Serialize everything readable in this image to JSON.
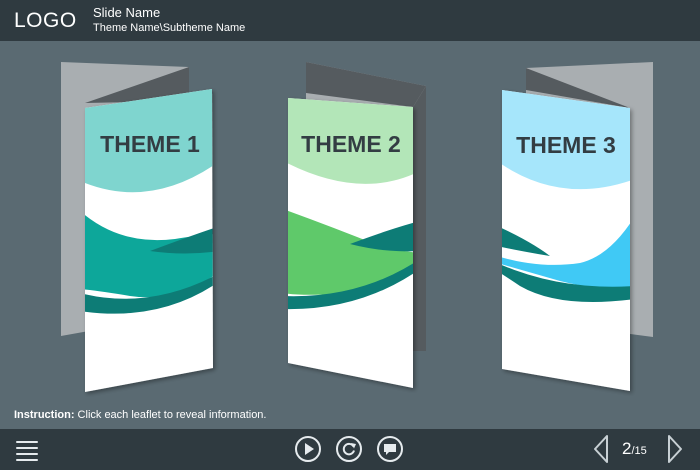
{
  "header": {
    "logo": "LOGO",
    "slide_name": "Slide Name",
    "theme_path": "Theme Name\\Subtheme Name"
  },
  "leaflets": [
    {
      "title": "THEME 1",
      "color_light": "#7fd5cf",
      "color_main": "#0ea79a",
      "color_dark": "#0b7b76"
    },
    {
      "title": "THEME 2",
      "color_light": "#b3e6b8",
      "color_main": "#5ec96a",
      "color_dark": "#0b7b76"
    },
    {
      "title": "THEME 3",
      "color_light": "#a6e6fb",
      "color_main": "#3fc9f5",
      "color_dark": "#0b7b76"
    }
  ],
  "instruction": {
    "label": "Instruction:",
    "text": " Click each leaflet to reveal information."
  },
  "footer": {
    "icons": [
      "menu-icon",
      "play-icon",
      "replay-icon",
      "comment-icon",
      "prev-arrow-icon",
      "next-arrow-icon"
    ],
    "page_current": "2",
    "page_total": "/15"
  },
  "colors": {
    "background": "#5a6a72",
    "bar": "#2f3a40"
  }
}
